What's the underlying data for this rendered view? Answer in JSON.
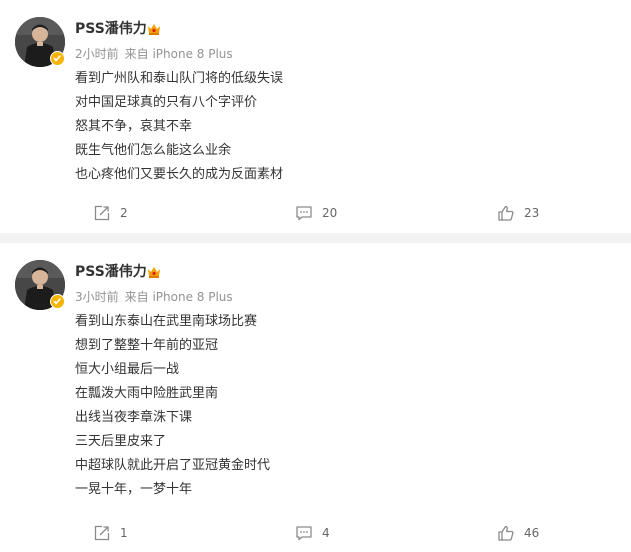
{
  "posts": [
    {
      "author": "PSS潘伟力",
      "time": "2小时前",
      "source": "来自 iPhone 8 Plus",
      "lines": [
        "看到广州队和泰山队门将的低级失误",
        "对中国足球真的只有八个字评价",
        "怒其不争，哀其不幸",
        "既生气他们怎么能这么业余",
        "也心疼他们又要长久的成为反面素材"
      ],
      "reposts": "2",
      "comments": "20",
      "likes": "23"
    },
    {
      "author": "PSS潘伟力",
      "time": "3小时前",
      "source": "来自 iPhone 8 Plus",
      "lines": [
        "看到山东泰山在武里南球场比赛",
        "想到了整整十年前的亚冠",
        "恒大小组最后一战",
        "在瓢泼大雨中险胜武里南",
        "出线当夜李章洙下课",
        "三天后里皮来了",
        "中超球队就此开启了亚冠黄金时代",
        "一晃十年，一梦十年"
      ],
      "reposts": "1",
      "comments": "4",
      "likes": "46"
    }
  ],
  "icons": {
    "avatar": "avatar-photo",
    "verified": "verified-badge-icon",
    "member": "vip-crown-icon",
    "repost": "repost-icon",
    "comment": "comment-icon",
    "like": "like-icon"
  },
  "colors": {
    "text": "#333333",
    "meta": "#939393",
    "divider": "#f2f2f2",
    "verified": "#f6b400",
    "icon": "#8a8a8a"
  }
}
